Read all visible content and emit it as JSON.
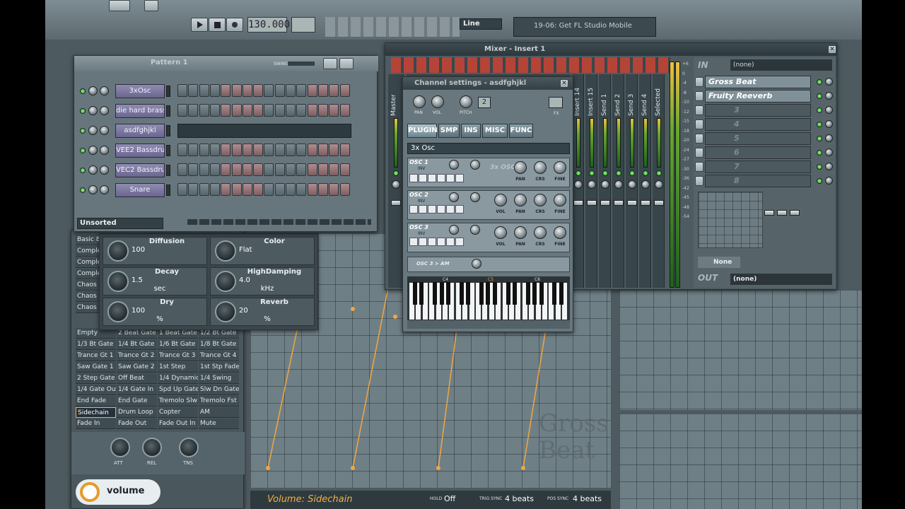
{
  "toolbar": {
    "tempo": "130.000",
    "mode": "Line",
    "hint": "19-06: Get FL Studio Mobile"
  },
  "step_seq": {
    "pattern": "Pattern 1",
    "swing_label": "SWING",
    "filter": "Unsorted",
    "channels": [
      {
        "name": "3xOsc",
        "steps": [
          0,
          0,
          0,
          0,
          1,
          1,
          1,
          1,
          0,
          0,
          0,
          0,
          1,
          1,
          1,
          1
        ]
      },
      {
        "name": "die hard brass",
        "steps": [
          0,
          0,
          0,
          0,
          1,
          1,
          1,
          1,
          0,
          0,
          0,
          0,
          1,
          1,
          1,
          1
        ]
      },
      {
        "name": "asdfghjkl",
        "steps": []
      },
      {
        "name": "VEE2 Bassdru...",
        "steps": [
          0,
          0,
          0,
          0,
          1,
          1,
          1,
          1,
          0,
          0,
          0,
          0,
          1,
          1,
          1,
          1
        ]
      },
      {
        "name": "VEC2 Bassdru...",
        "steps": [
          0,
          0,
          0,
          0,
          1,
          1,
          1,
          1,
          0,
          0,
          0,
          0,
          1,
          1,
          1,
          1
        ]
      },
      {
        "name": "Snare",
        "steps": [
          0,
          0,
          0,
          0,
          1,
          1,
          1,
          1,
          0,
          0,
          0,
          0,
          1,
          1,
          1,
          1
        ]
      }
    ]
  },
  "reverb": {
    "params": [
      {
        "label": "Diffusion",
        "value": "100",
        "unit": ""
      },
      {
        "label": "Color",
        "value": "Flat",
        "unit": ""
      },
      {
        "label": "Decay",
        "value": "1.5",
        "unit": "sec"
      },
      {
        "label": "HighDamping",
        "value": "4.0",
        "unit": "kHz"
      },
      {
        "label": "Dry",
        "value": "100",
        "unit": "%"
      },
      {
        "label": "Reverb",
        "value": "20",
        "unit": "%"
      }
    ]
  },
  "gross_beat": {
    "side_items": [
      "Basic 8",
      "Comple",
      "Comple",
      "Comple",
      "Chaos",
      "Chaos",
      "Chaos"
    ],
    "presets": [
      [
        "Empty",
        "2 Beat Gate",
        "1 Beat Gate",
        "1/2 Bt Gate"
      ],
      [
        "1/3 Bt Gate",
        "1/4 Bt Gate",
        "1/6 Bt Gate",
        "1/8 Bt Gate"
      ],
      [
        "Trance Gt 1",
        "Trance Gt 2",
        "Trance Gt 3",
        "Trance Gt 4"
      ],
      [
        "Saw Gate 1",
        "Saw Gate 2",
        "1st Step",
        "1st Stp Fade"
      ],
      [
        "2 Step Gate",
        "Off Beat",
        "1/4 Dynamic",
        "1/4 Swing"
      ],
      [
        "1/4 Gate Out",
        "1/4 Gate In",
        "Spd Up Gate",
        "Slw Dn Gate"
      ],
      [
        "End Fade",
        "End Gate",
        "Tremolo Slw",
        "Tremolo Fst"
      ],
      [
        "Sidechain",
        "Drum Loop",
        "Copter",
        "AM"
      ],
      [
        "Fade In",
        "Fade Out",
        "Fade Out In",
        "Mute"
      ]
    ],
    "knob_labels": [
      "ATT",
      "REL",
      "TNS"
    ],
    "mode_label": "volume",
    "status": "Volume: Sidechain",
    "hold_label": "HOLD",
    "hold_value": "Off",
    "trig_label": "TRIG SYNC",
    "trig_value": "4 beats",
    "pos_label": "POS SYNC",
    "pos_value": "4 beats",
    "watermark": [
      "Gross",
      "Beat"
    ]
  },
  "mixer": {
    "title": "Mixer - Insert 1",
    "strips": [
      "Master",
      "Insert 14",
      "Insert 15",
      "Send 1",
      "Send 2",
      "Send 3",
      "Send 4",
      "Selected"
    ],
    "in_label": "IN",
    "in_value": "(none)",
    "out_label": "OUT",
    "out_value": "(none)",
    "slots": [
      "Gross Beat",
      "Fruity Reeverb",
      "3",
      "4",
      "5",
      "6",
      "7",
      "8"
    ],
    "none_label": "None",
    "db_ticks": [
      "+6",
      "0",
      "-4",
      "-8",
      "-10",
      "-12",
      "-15",
      "-18",
      "-20",
      "-24",
      "-27",
      "-30",
      "-36",
      "-42",
      "-45",
      "-48",
      "-54"
    ]
  },
  "channel_settings": {
    "title": "Channel settings - asdfghjkl",
    "knob_labels": [
      "PAN",
      "VOL",
      "PITCH"
    ],
    "fx_label": "FX",
    "fx_number": "2",
    "tabs": [
      "PLUGIN",
      "SMP",
      "INS",
      "MISC",
      "FUNC"
    ],
    "plugin": "3x Osc",
    "osc": [
      {
        "label": "OSC 1",
        "knobs": [
          "PAN",
          "CRS",
          "FINE"
        ]
      },
      {
        "label": "OSC 2",
        "knobs": [
          "VOL",
          "PAN",
          "CRS",
          "FINE"
        ]
      },
      {
        "label": "OSC 3",
        "knobs": [
          "VOL",
          "PAN",
          "CRS",
          "FINE"
        ]
      }
    ],
    "inv": "INV",
    "logo": "3x OSC",
    "osc3am": "OSC 3 > AM",
    "keys_labels": [
      "C4",
      "C5",
      "C6"
    ]
  }
}
